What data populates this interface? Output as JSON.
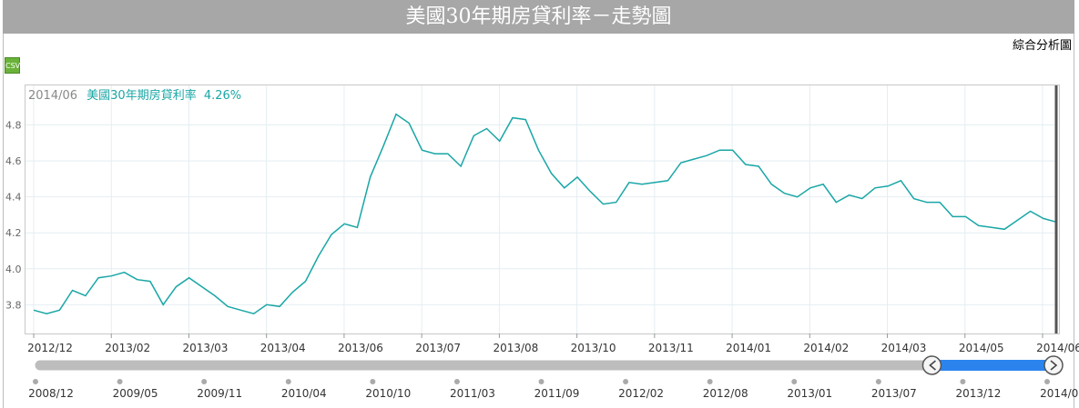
{
  "header": {
    "title": "美國30年期房貸利率－走勢圖"
  },
  "toolbar": {
    "analysis_label": "綜合分析圖",
    "csv_label": "CSV"
  },
  "tooltip": {
    "date": "2014/06",
    "series_name": "美國30年期房貸利率",
    "value": "4.26%"
  },
  "colors": {
    "line": "#1aa6a6",
    "navigator_fill": "#2b84ee",
    "navigator_bar": "#bdbdbd",
    "title_bg": "#a7a7a7",
    "cursor": "#555555"
  },
  "chart_data": {
    "type": "line",
    "series": [
      {
        "name": "美國30年期房貸利率",
        "values": [
          3.77,
          3.75,
          3.77,
          3.88,
          3.85,
          3.95,
          3.96,
          3.98,
          3.94,
          3.93,
          3.8,
          3.9,
          3.95,
          3.9,
          3.85,
          3.79,
          3.77,
          3.75,
          3.8,
          3.79,
          3.87,
          3.93,
          4.07,
          4.19,
          4.25,
          4.23,
          4.51,
          4.68,
          4.86,
          4.81,
          4.66,
          4.64,
          4.64,
          4.57,
          4.74,
          4.78,
          4.71,
          4.84,
          4.83,
          4.66,
          4.53,
          4.45,
          4.51,
          4.43,
          4.36,
          4.37,
          4.48,
          4.47,
          4.48,
          4.49,
          4.59,
          4.61,
          4.63,
          4.66,
          4.66,
          4.58,
          4.57,
          4.47,
          4.42,
          4.4,
          4.45,
          4.47,
          4.37,
          4.41,
          4.39,
          4.45,
          4.46,
          4.49,
          4.39,
          4.37,
          4.37,
          4.29,
          4.29,
          4.24,
          4.23,
          4.22,
          4.27,
          4.32,
          4.28,
          4.26
        ]
      }
    ],
    "y_ticks": [
      "3.8",
      "4.0",
      "4.2",
      "4.4",
      "4.6",
      "4.8"
    ],
    "ylim": [
      3.64,
      5.02
    ],
    "x_ticks": [
      "2012/12",
      "2013/02",
      "2013/03",
      "2013/04",
      "2013/06",
      "2013/07",
      "2013/08",
      "2013/10",
      "2013/11",
      "2014/01",
      "2014/02",
      "2014/03",
      "2014/05",
      "2014/06"
    ],
    "grid": true,
    "navigator": {
      "labels": [
        "2008/12",
        "2009/05",
        "2009/11",
        "2010/04",
        "2010/10",
        "2011/03",
        "2011/09",
        "2012/02",
        "2012/08",
        "2013/01",
        "2013/07",
        "2013/12",
        "2014/06"
      ],
      "selected_from": 0.88,
      "selected_to": 1.0
    }
  }
}
